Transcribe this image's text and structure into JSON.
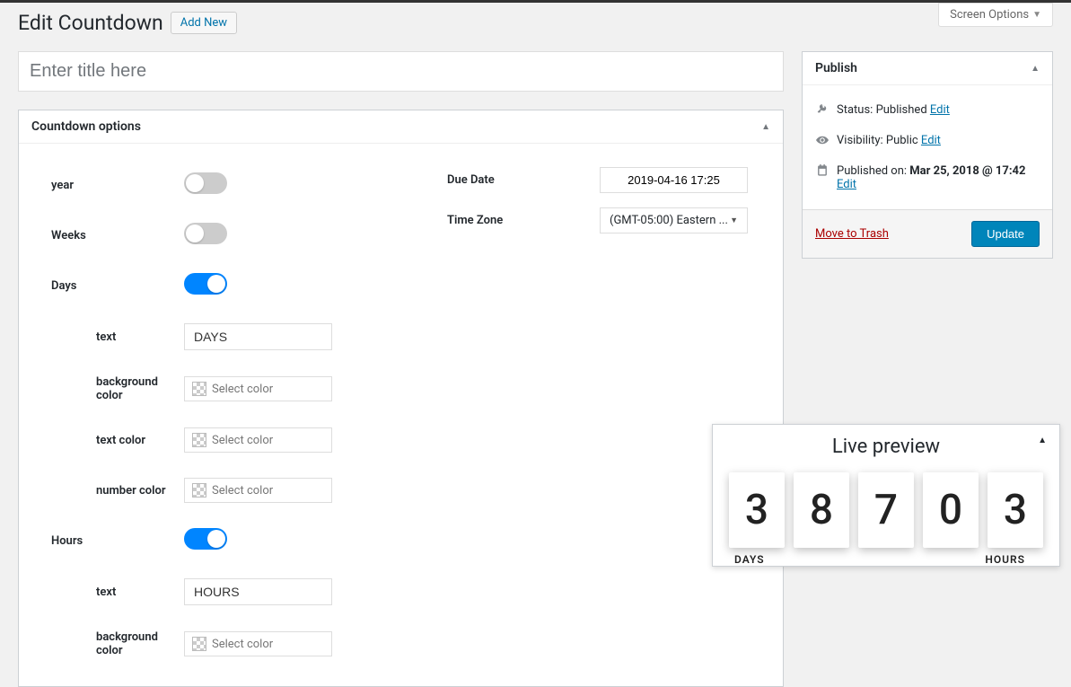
{
  "header": {
    "page_title": "Edit Countdown",
    "add_new": "Add New",
    "screen_options": "Screen Options"
  },
  "title_input": {
    "placeholder": "Enter title here",
    "value": ""
  },
  "options_box": {
    "title": "Countdown options",
    "left": {
      "year": {
        "label": "year",
        "on": false
      },
      "weeks": {
        "label": "Weeks",
        "on": false
      },
      "days": {
        "label": "Days",
        "on": true,
        "text_label": "text",
        "text_value": "DAYS",
        "bg_color_label": "background color",
        "bg_color_ph": "Select color",
        "txt_color_label": "text color",
        "txt_color_ph": "Select color",
        "num_color_label": "number color",
        "num_color_ph": "Select color"
      },
      "hours": {
        "label": "Hours",
        "on": true,
        "text_label": "text",
        "text_value": "HOURS",
        "bg_color_label": "background color",
        "bg_color_ph": "Select color"
      }
    },
    "right": {
      "due_label": "Due Date",
      "due_value": "2019-04-16 17:25",
      "tz_label": "Time Zone",
      "tz_value": "(GMT-05:00) Eastern ..."
    }
  },
  "publish": {
    "title": "Publish",
    "status_label": "Status:",
    "status_value": "Published",
    "status_edit": "Edit",
    "visibility_label": "Visibility:",
    "visibility_value": "Public",
    "visibility_edit": "Edit",
    "published_on_label": "Published on:",
    "published_on_value": "Mar 25, 2018 @ 17:42",
    "published_on_edit": "Edit",
    "trash": "Move to Trash",
    "update": "Update"
  },
  "preview": {
    "title": "Live preview",
    "digits": [
      "3",
      "8",
      "7",
      "0",
      "3"
    ],
    "label_days": "DAYS",
    "label_hours": "HOURS"
  }
}
